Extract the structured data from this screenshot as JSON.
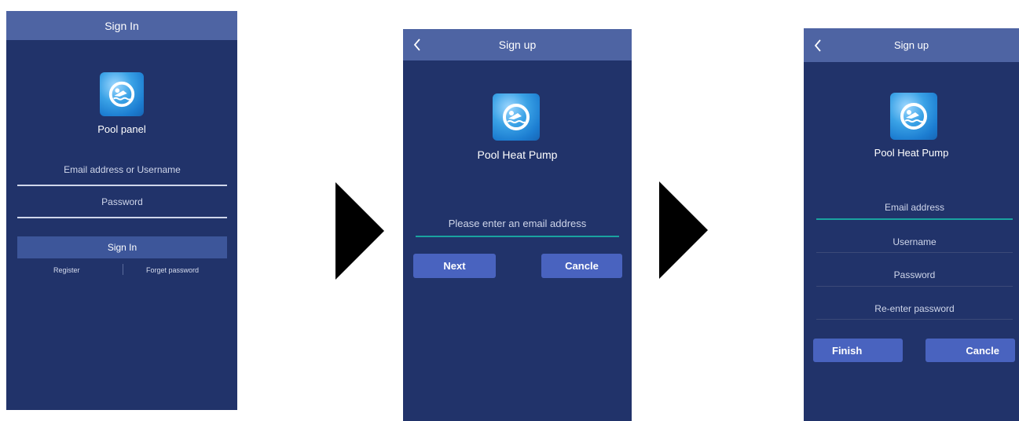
{
  "screens": [
    {
      "title": "Sign In",
      "app_name": "Pool panel",
      "fields": [
        "Email address or Username",
        "Password"
      ],
      "primary_button": "Sign In",
      "links": [
        "Register",
        "Forget password"
      ]
    },
    {
      "title": "Sign up",
      "app_name": "Pool Heat Pump",
      "fields": [
        "Please enter an email address"
      ],
      "buttons": [
        "Next",
        "Cancle"
      ]
    },
    {
      "title": "Sign up",
      "app_name": "Pool Heat Pump",
      "fields": [
        "Email address",
        "Username",
        "Password",
        "Re-enter password"
      ],
      "buttons": [
        "Finish",
        "Cancle"
      ]
    }
  ],
  "icons": {
    "back": "chevron-left-icon",
    "logo": "pool-swimmer-icon",
    "flow": "play-arrow-icon"
  },
  "colors": {
    "background": "#21336a",
    "topbar": "#4e64a3",
    "button": "#4963bf",
    "accent_line": "#1aa3a0"
  }
}
